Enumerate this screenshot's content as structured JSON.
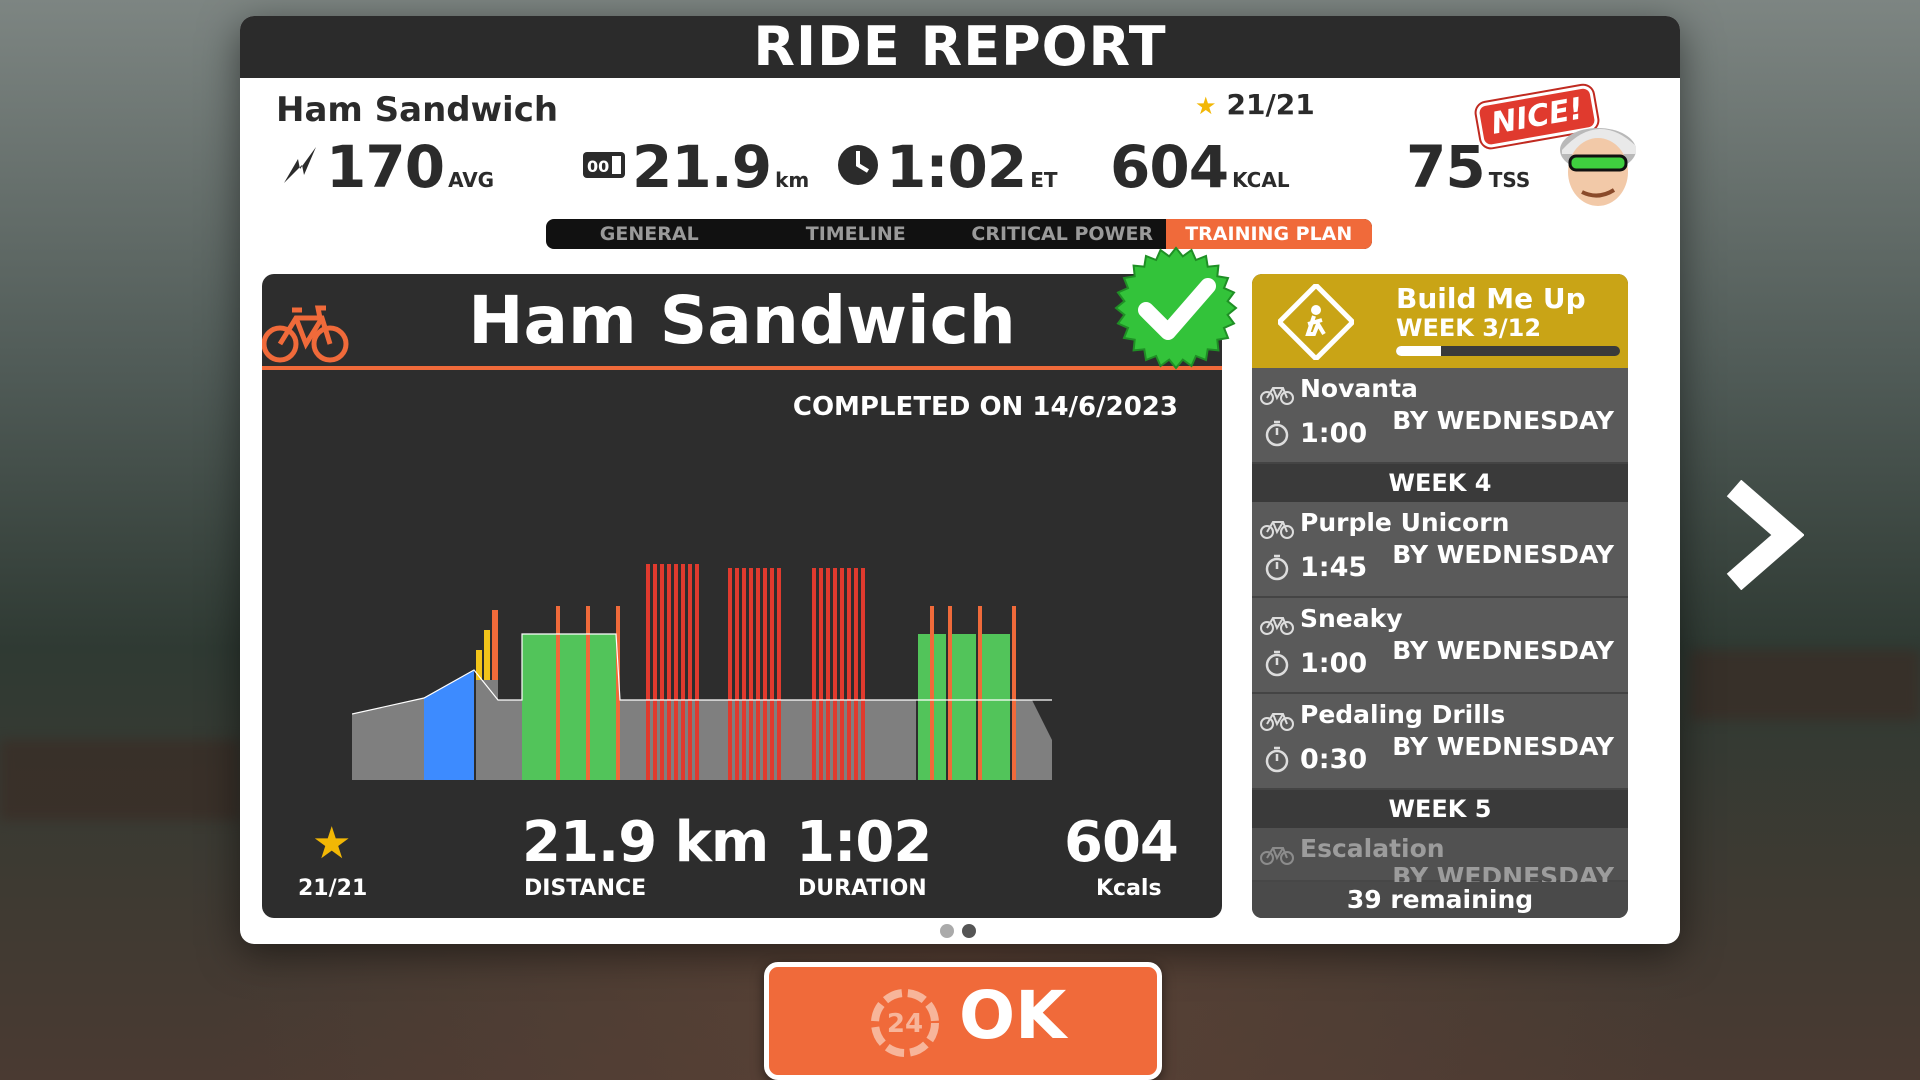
{
  "modal": {
    "title": "RIDE REPORT"
  },
  "rider": {
    "name": "Ham Sandwich",
    "stars": "21/21"
  },
  "summary": {
    "power": {
      "value": "170",
      "unit": "AVG"
    },
    "distance": {
      "value": "21.9",
      "unit": "km"
    },
    "time": {
      "value": "1:02",
      "unit": "ET"
    },
    "energy": {
      "value": "604",
      "unit": "KCAL"
    },
    "tss": {
      "value": "75",
      "unit": "TSS"
    }
  },
  "badge": {
    "nice": "NICE!"
  },
  "tabs": [
    {
      "label": "GENERAL"
    },
    {
      "label": "TIMELINE"
    },
    {
      "label": "CRITICAL POWER"
    },
    {
      "label": "TRAINING PLAN"
    }
  ],
  "workout_card": {
    "title": "Ham Sandwich",
    "completed": "COMPLETED ON 14/6/2023",
    "stars": "21/21",
    "distance_value": "21.9 km",
    "distance_label": "DISTANCE",
    "duration_value": "1:02",
    "duration_label": "DURATION",
    "kcal_value": "604",
    "kcal_label": "Kcals"
  },
  "plan": {
    "title": "Build Me Up",
    "week": "WEEK 3/12",
    "progress": 0.2,
    "weeks": [
      {
        "header": "",
        "workouts": [
          {
            "name": "Novanta",
            "time": "1:00",
            "due": "BY WEDNESDAY"
          }
        ]
      },
      {
        "header": "WEEK 4",
        "workouts": [
          {
            "name": "Purple Unicorn",
            "time": "1:45",
            "due": "BY WEDNESDAY"
          },
          {
            "name": "Sneaky",
            "time": "1:00",
            "due": "BY WEDNESDAY"
          },
          {
            "name": "Pedaling Drills",
            "time": "0:30",
            "due": "BY WEDNESDAY"
          }
        ]
      },
      {
        "header": "WEEK 5",
        "workouts": [
          {
            "name": "Escalation",
            "time": "",
            "due": "BY WEDNESDAY"
          }
        ]
      }
    ],
    "remaining": "39 remaining"
  },
  "ok_button": {
    "label": "OK",
    "countdown": "24"
  },
  "colors": {
    "accent": "#f06a3a",
    "plan_gold": "#c9a416",
    "card_bg": "#2d2d2d",
    "z1": "#7f7f7f",
    "z2": "#3d8bff",
    "z3": "#52c45a",
    "z4": "#f2c41a",
    "z5": "#f06a3a",
    "z6": "#e03a2e"
  }
}
